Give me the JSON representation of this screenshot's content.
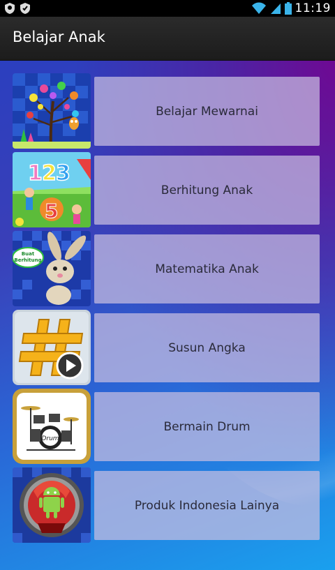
{
  "status_bar": {
    "time": "11:19",
    "icons": [
      "shield-icon",
      "shield-check-icon",
      "wifi-icon",
      "signal-icon",
      "battery-icon"
    ]
  },
  "action_bar": {
    "title": "Belajar Anak"
  },
  "menu": [
    {
      "label": "Belajar Mewarnai",
      "icon": "coloring-tree-icon"
    },
    {
      "label": "Berhitung Anak",
      "icon": "counting-kids-icon"
    },
    {
      "label": "Matematika Anak",
      "icon": "math-rabbit-icon",
      "badge_text": "Buat Berhitung"
    },
    {
      "label": "Susun Angka",
      "icon": "hash-play-icon"
    },
    {
      "label": "Bermain Drum",
      "icon": "drum-kit-icon"
    },
    {
      "label": "Produk Indonesia Lainya",
      "icon": "android-robot-icon"
    }
  ],
  "colors": {
    "action_bar": "#222222",
    "button_bg": "#c8bee1",
    "button_text": "#2a2a3a"
  }
}
